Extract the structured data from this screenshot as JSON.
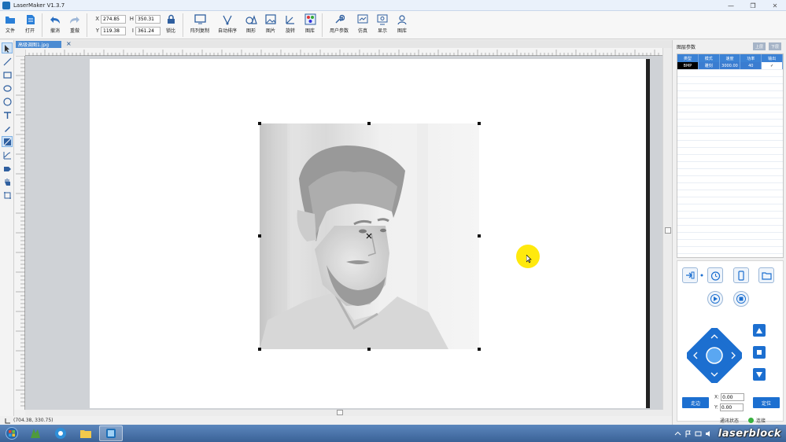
{
  "window": {
    "title": "LaserMaker V1.3.7"
  },
  "toolbar": {
    "file": "文件",
    "open": "打开",
    "undo": "撤消",
    "redo": "重做",
    "coords": {
      "x_label": "X",
      "y_label": "Y",
      "w_label": "H",
      "h_label": "I",
      "x": "274.85",
      "y": "119.38",
      "w": "350.31",
      "h": "361.24"
    },
    "lock": "锁比",
    "array_copy": "阵列复制",
    "auto_layout": "自动排序",
    "shape": "图形",
    "image": "图片",
    "rotate": "旋转",
    "gallery": "图库",
    "user_params": "用户参数",
    "tools": "仿真",
    "display": "显示",
    "library": "图库"
  },
  "document": {
    "tab_label": "高级调图1.jpg",
    "tab_close": "×"
  },
  "statusbar": {
    "cursor": "(704.38, 330.75)"
  },
  "layers_panel": {
    "title": "图层参数",
    "btn_up": "上层",
    "btn_down": "下层",
    "columns": [
      "类型",
      "模式",
      "速度",
      "功率",
      "输出"
    ],
    "rows": [
      {
        "type": "BMP",
        "mode": "雕刻",
        "speed": "3000.00",
        "power": "40",
        "output": "✓"
      }
    ]
  },
  "control_panel": {
    "start_label": "走边",
    "origin_label": "定位",
    "x_label": "X:",
    "y_label": "Y:",
    "x_value": "0.00",
    "y_value": "0.00",
    "status_label": "通讯状态",
    "connection": "连接"
  },
  "taskbar": {
    "brand": "laserblock"
  },
  "colors": {
    "accent": "#1c6fd0",
    "header": "#3b82d5",
    "taskbar": "#4a74aa"
  }
}
